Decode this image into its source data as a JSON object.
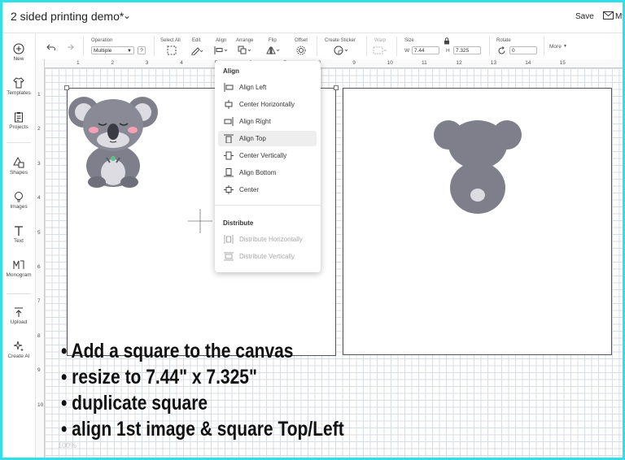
{
  "header": {
    "title": "2 sided printing demo*",
    "save_label": "Save",
    "right_text": "My"
  },
  "sidebar": {
    "items": [
      {
        "label": "New",
        "icon": "plus-circle-icon"
      },
      {
        "label": "Templates",
        "icon": "shirt-icon"
      },
      {
        "label": "Projects",
        "icon": "clipboard-icon"
      },
      {
        "label": "Shapes",
        "icon": "shapes-icon"
      },
      {
        "label": "Images",
        "icon": "lightbulb-icon"
      },
      {
        "label": "Text",
        "icon": "text-t-icon"
      },
      {
        "label": "Monogram",
        "icon": "monogram-icon"
      },
      {
        "label": "Upload",
        "icon": "upload-icon"
      },
      {
        "label": "Create AI",
        "icon": "sparkle-icon"
      }
    ]
  },
  "toolbar": {
    "operation_label": "Operation",
    "operation_value": "Multiple",
    "help": "?",
    "select_all_label": "Select All",
    "edit_label": "Edit",
    "align_label": "Align",
    "arrange_label": "Arrange",
    "flip_label": "Flip",
    "offset_label": "Offset",
    "create_sticker_label": "Create Sticker",
    "warp_label": "Warp",
    "size_label": "Size",
    "w_label": "W",
    "w_value": "7.44",
    "h_label": "H",
    "h_value": "7.325",
    "rotate_label": "Rotate",
    "rotate_value": "0",
    "more_label": "More"
  },
  "ruler": {
    "top": [
      "1",
      "2",
      "3",
      "4",
      "5",
      "6",
      "7",
      "8",
      "9",
      "10",
      "11",
      "12",
      "13",
      "14",
      "15"
    ],
    "left": [
      "1",
      "2",
      "3",
      "4",
      "5",
      "6",
      "7",
      "8",
      "9",
      "10"
    ]
  },
  "canvas": {
    "zoom": "100%"
  },
  "align_menu": {
    "align_heading": "Align",
    "align_items": [
      {
        "label": "Align Left",
        "icon": "align-left-icon"
      },
      {
        "label": "Center Horizontally",
        "icon": "center-horizontally-icon"
      },
      {
        "label": "Align Right",
        "icon": "align-right-icon"
      },
      {
        "label": "Align Top",
        "icon": "align-top-icon"
      },
      {
        "label": "Center Vertically",
        "icon": "center-vertically-icon"
      },
      {
        "label": "Align Bottom",
        "icon": "align-bottom-icon"
      },
      {
        "label": "Center",
        "icon": "center-icon"
      }
    ],
    "distribute_heading": "Distribute",
    "distribute_items": [
      {
        "label": "Distribute Horizontally",
        "icon": "distribute-horizontally-icon"
      },
      {
        "label": "Distribute Vertically",
        "icon": "distribute-vertically-icon"
      }
    ]
  },
  "instructions": [
    "• Add a square to the canvas",
    "• resize to 7.44\" x 7.325\"",
    "• duplicate square",
    "• align 1st image & square Top/Left"
  ],
  "colors": {
    "frame": "#2fe0e8",
    "koala": "#7f7f8c",
    "cheek": "#f6a0b4",
    "nose": "#3a3a44"
  }
}
